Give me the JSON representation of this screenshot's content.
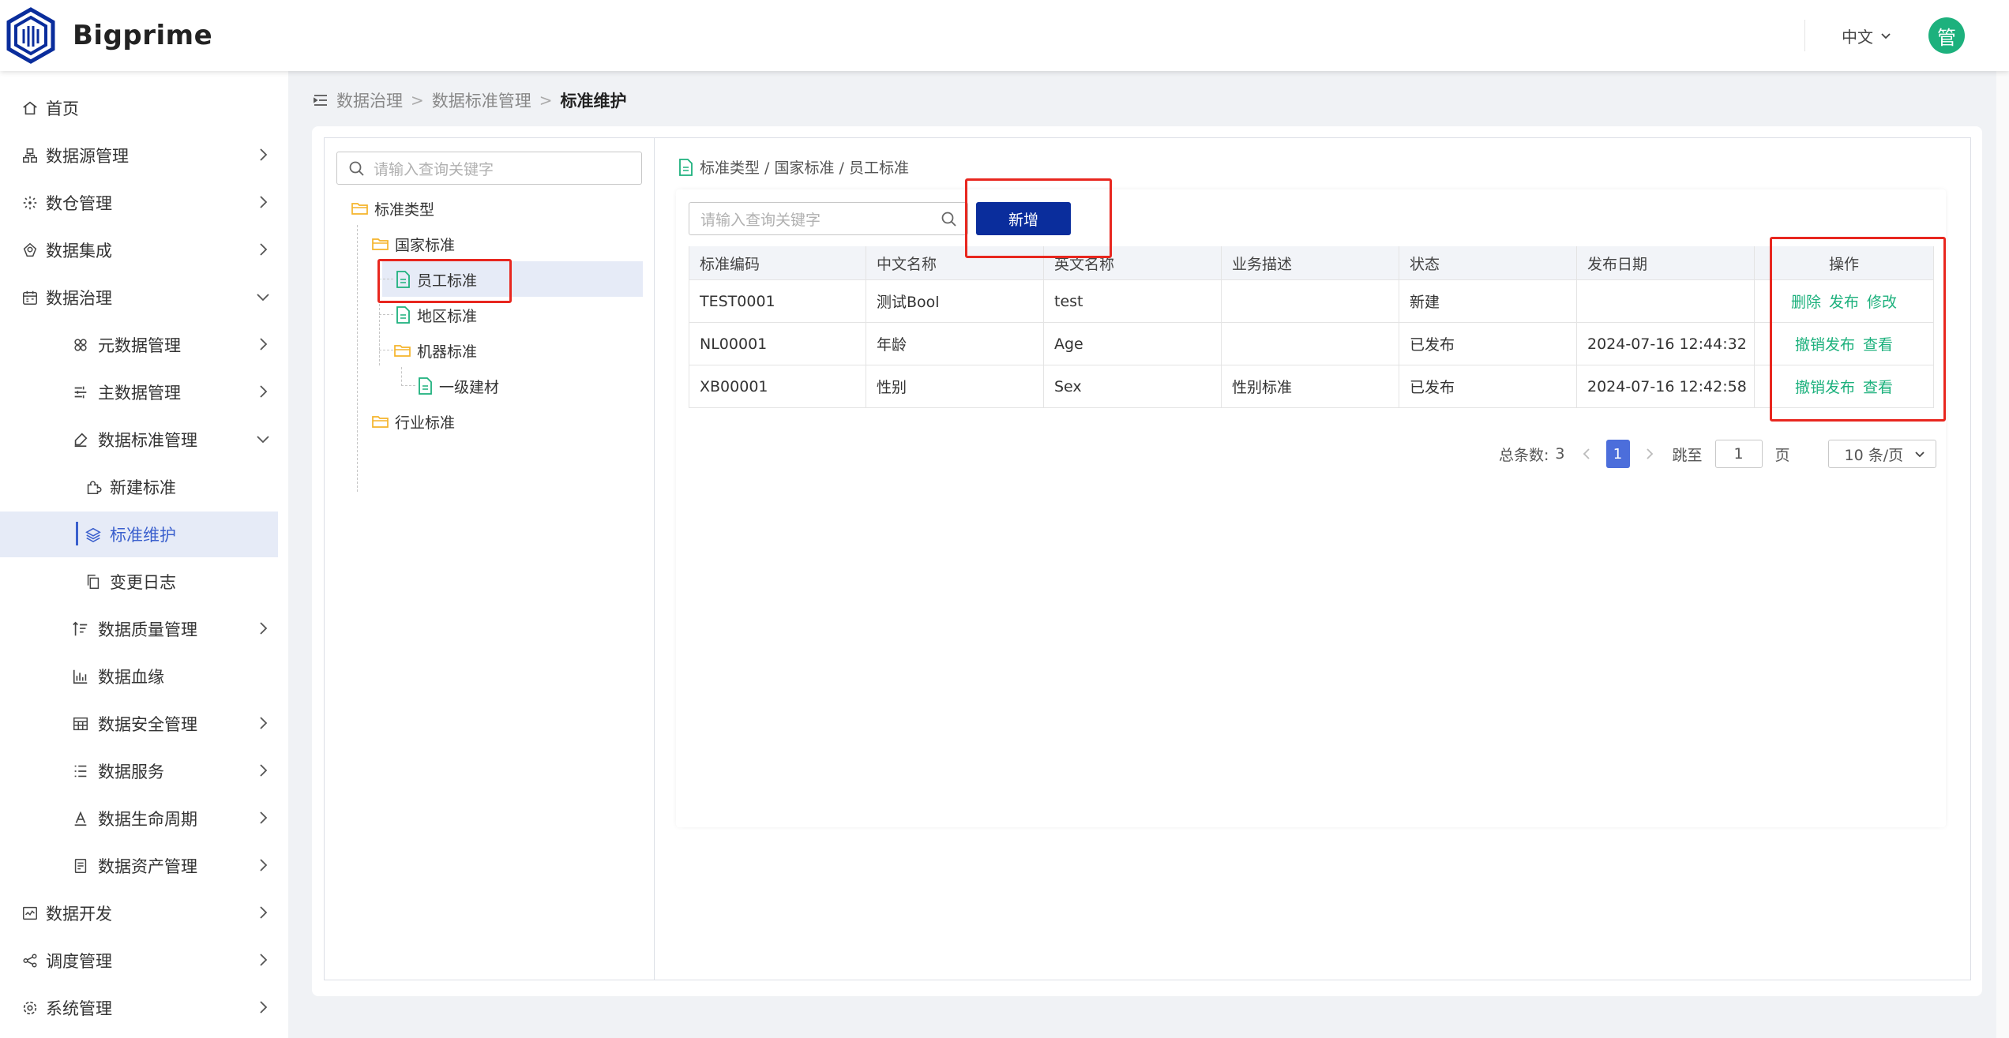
{
  "app": {
    "brand": "Bigprime",
    "language": "中文",
    "user_initial": "管"
  },
  "colors": {
    "accent": "#3a5fcd",
    "primary_button": "#0a2d9c",
    "action_link": "#1db17d",
    "avatar": "#1db17d",
    "highlight_box": "#e8271f",
    "folder": "#f5b42a",
    "doc": "#1db17d"
  },
  "sidebar": {
    "items": [
      {
        "label": "首页",
        "icon": "home-icon",
        "level": 1,
        "arrow": ""
      },
      {
        "label": "数据源管理",
        "icon": "datasource-icon",
        "level": 1,
        "arrow": "right"
      },
      {
        "label": "数仓管理",
        "icon": "warehouse-icon",
        "level": 1,
        "arrow": "right"
      },
      {
        "label": "数据集成",
        "icon": "integration-icon",
        "level": 1,
        "arrow": "right"
      },
      {
        "label": "数据治理",
        "icon": "governance-icon",
        "level": 1,
        "arrow": "down"
      },
      {
        "label": "元数据管理",
        "icon": "metadata-icon",
        "level": 2,
        "arrow": "right"
      },
      {
        "label": "主数据管理",
        "icon": "masterdata-icon",
        "level": 2,
        "arrow": "right"
      },
      {
        "label": "数据标准管理",
        "icon": "standard-icon",
        "level": 2,
        "arrow": "down"
      },
      {
        "label": "新建标准",
        "icon": "puzzle-icon",
        "level": 3,
        "arrow": ""
      },
      {
        "label": "标准维护",
        "icon": "layers-icon",
        "level": 3,
        "arrow": "",
        "active": true
      },
      {
        "label": "变更日志",
        "icon": "copy-icon",
        "level": 3,
        "arrow": ""
      },
      {
        "label": "数据质量管理",
        "icon": "quality-icon",
        "level": 2,
        "arrow": "right"
      },
      {
        "label": "数据血缘",
        "icon": "lineage-icon",
        "level": 2,
        "arrow": ""
      },
      {
        "label": "数据安全管理",
        "icon": "security-icon",
        "level": 2,
        "arrow": "right"
      },
      {
        "label": "数据服务",
        "icon": "service-icon",
        "level": 2,
        "arrow": "right"
      },
      {
        "label": "数据生命周期",
        "icon": "lifecycle-icon",
        "level": 2,
        "arrow": "right"
      },
      {
        "label": "数据资产管理",
        "icon": "asset-icon",
        "level": 2,
        "arrow": "right"
      },
      {
        "label": "数据开发",
        "icon": "develop-icon",
        "level": 1,
        "arrow": "right"
      },
      {
        "label": "调度管理",
        "icon": "schedule-icon",
        "level": 1,
        "arrow": "right"
      },
      {
        "label": "系统管理",
        "icon": "settings-icon",
        "level": 1,
        "arrow": "right"
      }
    ]
  },
  "breadcrumb": {
    "items": [
      "数据治理",
      "数据标准管理",
      "标准维护"
    ]
  },
  "tree": {
    "search_placeholder": "请输入查询关键字",
    "nodes": [
      {
        "label": "标准类型",
        "type": "folder"
      },
      {
        "label": "国家标准",
        "type": "folder"
      },
      {
        "label": "员工标准",
        "type": "doc",
        "selected": true
      },
      {
        "label": "地区标准",
        "type": "doc"
      },
      {
        "label": "机器标准",
        "type": "folder"
      },
      {
        "label": "一级建材",
        "type": "doc"
      },
      {
        "label": "行业标准",
        "type": "folder"
      }
    ]
  },
  "detail": {
    "path": "标准类型 / 国家标准 / 员工标准",
    "search_placeholder": "请输入查询关键字",
    "add_label": "新增"
  },
  "table": {
    "columns": [
      "标准编码",
      "中文名称",
      "英文名称",
      "业务描述",
      "状态",
      "发布日期",
      "操作"
    ],
    "rows": [
      {
        "code": "TEST0001",
        "cn": "测试Bool",
        "en": "test",
        "desc": "",
        "status": "新建",
        "date": "",
        "ops": [
          "删除",
          "发布",
          "修改"
        ]
      },
      {
        "code": "NL00001",
        "cn": "年龄",
        "en": "Age",
        "desc": "",
        "status": "已发布",
        "date": "2024-07-16 12:44:32",
        "ops": [
          "撤销发布",
          "查看"
        ]
      },
      {
        "code": "XB00001",
        "cn": "性别",
        "en": "Sex",
        "desc": "性别标准",
        "status": "已发布",
        "date": "2024-07-16 12:42:58",
        "ops": [
          "撤销发布",
          "查看"
        ]
      }
    ]
  },
  "pagination": {
    "total_label": "总条数:",
    "total": "3",
    "current_page": "1",
    "jump_label": "跳至",
    "jump_value": "1",
    "page_unit": "页",
    "page_size": "10 条/页"
  }
}
